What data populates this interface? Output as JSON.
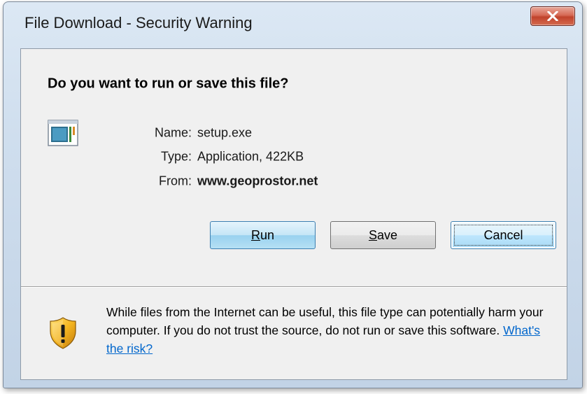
{
  "window": {
    "title": "File Download - Security Warning",
    "close_label": "X"
  },
  "dialog": {
    "heading": "Do you want to run or save this file?",
    "fields": {
      "name_label": "Name:",
      "name_value": "setup.exe",
      "type_label": "Type:",
      "type_value": "Application, 422KB",
      "from_label": "From:",
      "from_value": "www.geoprostor.net"
    },
    "buttons": {
      "run_mnemonic": "R",
      "run_rest": "un",
      "save_mnemonic": "S",
      "save_rest": "ave",
      "cancel": "Cancel"
    },
    "warning": {
      "text": "While files from the Internet can be useful, this file type can potentially harm your computer. If you do not trust the source, do not run or save this software.",
      "link": "What's the risk?"
    }
  },
  "icons": {
    "file": "application-file-icon",
    "warning": "warning-shield-icon",
    "close": "close-icon"
  }
}
